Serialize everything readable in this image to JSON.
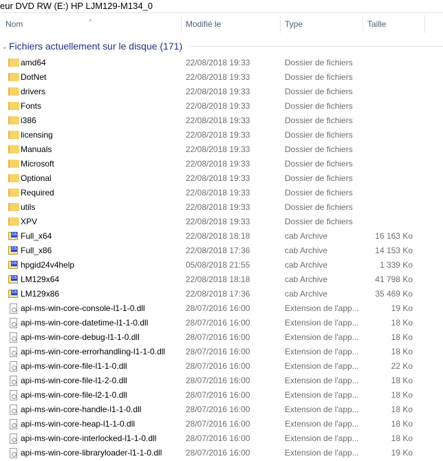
{
  "window": {
    "title": "eur DVD RW (E:) HP LJM129-M134_0"
  },
  "columns": {
    "name": "Nom",
    "modified": "Modifié le",
    "type": "Type",
    "size": "Taille"
  },
  "group": {
    "label": "Fichiers actuellement sur le disque (171)"
  },
  "files": [
    {
      "name": "amd64",
      "date": "22/08/2018 19:33",
      "type": "Dossier de fichiers",
      "size": "",
      "icon": "folder"
    },
    {
      "name": "DotNet",
      "date": "22/08/2018 19:33",
      "type": "Dossier de fichiers",
      "size": "",
      "icon": "folder"
    },
    {
      "name": "drivers",
      "date": "22/08/2018 19:33",
      "type": "Dossier de fichiers",
      "size": "",
      "icon": "folder"
    },
    {
      "name": "Fonts",
      "date": "22/08/2018 19:33",
      "type": "Dossier de fichiers",
      "size": "",
      "icon": "folder"
    },
    {
      "name": "i386",
      "date": "22/08/2018 19:33",
      "type": "Dossier de fichiers",
      "size": "",
      "icon": "folder"
    },
    {
      "name": "licensing",
      "date": "22/08/2018 19:33",
      "type": "Dossier de fichiers",
      "size": "",
      "icon": "folder"
    },
    {
      "name": "Manuals",
      "date": "22/08/2018 19:33",
      "type": "Dossier de fichiers",
      "size": "",
      "icon": "folder"
    },
    {
      "name": "Microsoft",
      "date": "22/08/2018 19:33",
      "type": "Dossier de fichiers",
      "size": "",
      "icon": "folder"
    },
    {
      "name": "Optional",
      "date": "22/08/2018 19:33",
      "type": "Dossier de fichiers",
      "size": "",
      "icon": "folder"
    },
    {
      "name": "Required",
      "date": "22/08/2018 19:33",
      "type": "Dossier de fichiers",
      "size": "",
      "icon": "folder"
    },
    {
      "name": "utils",
      "date": "22/08/2018 19:33",
      "type": "Dossier de fichiers",
      "size": "",
      "icon": "folder"
    },
    {
      "name": "XPV",
      "date": "22/08/2018 19:33",
      "type": "Dossier de fichiers",
      "size": "",
      "icon": "folder"
    },
    {
      "name": "Full_x64",
      "date": "22/08/2018 18:18",
      "type": "cab Archive",
      "size": "16 163 Ko",
      "icon": "cab"
    },
    {
      "name": "Full_x86",
      "date": "22/08/2018 17:36",
      "type": "cab Archive",
      "size": "14 153 Ko",
      "icon": "cab"
    },
    {
      "name": "hpgid24v4help",
      "date": "05/08/2018 21:55",
      "type": "cab Archive",
      "size": "1 339 Ko",
      "icon": "cab"
    },
    {
      "name": "LM129x64",
      "date": "22/08/2018 18:18",
      "type": "cab Archive",
      "size": "41 798 Ko",
      "icon": "cab"
    },
    {
      "name": "LM129x86",
      "date": "22/08/2018 17:36",
      "type": "cab Archive",
      "size": "35 469 Ko",
      "icon": "cab"
    },
    {
      "name": "api-ms-win-core-console-l1-1-0.dll",
      "date": "28/07/2016 16:00",
      "type": "Extension de l'app...",
      "size": "19 Ko",
      "icon": "dll"
    },
    {
      "name": "api-ms-win-core-datetime-l1-1-0.dll",
      "date": "28/07/2016 16:00",
      "type": "Extension de l'app...",
      "size": "18 Ko",
      "icon": "dll"
    },
    {
      "name": "api-ms-win-core-debug-l1-1-0.dll",
      "date": "28/07/2016 16:00",
      "type": "Extension de l'app...",
      "size": "18 Ko",
      "icon": "dll"
    },
    {
      "name": "api-ms-win-core-errorhandling-l1-1-0.dll",
      "date": "28/07/2016 16:00",
      "type": "Extension de l'app...",
      "size": "18 Ko",
      "icon": "dll"
    },
    {
      "name": "api-ms-win-core-file-l1-1-0.dll",
      "date": "28/07/2016 16:00",
      "type": "Extension de l'app...",
      "size": "22 Ko",
      "icon": "dll"
    },
    {
      "name": "api-ms-win-core-file-l1-2-0.dll",
      "date": "28/07/2016 16:00",
      "type": "Extension de l'app...",
      "size": "18 Ko",
      "icon": "dll"
    },
    {
      "name": "api-ms-win-core-file-l2-1-0.dll",
      "date": "28/07/2016 16:00",
      "type": "Extension de l'app...",
      "size": "18 Ko",
      "icon": "dll"
    },
    {
      "name": "api-ms-win-core-handle-l1-1-0.dll",
      "date": "28/07/2016 16:00",
      "type": "Extension de l'app...",
      "size": "18 Ko",
      "icon": "dll"
    },
    {
      "name": "api-ms-win-core-heap-l1-1-0.dll",
      "date": "28/07/2016 16:00",
      "type": "Extension de l'app...",
      "size": "18 Ko",
      "icon": "dll"
    },
    {
      "name": "api-ms-win-core-interlocked-l1-1-0.dll",
      "date": "28/07/2016 16:00",
      "type": "Extension de l'app...",
      "size": "18 Ko",
      "icon": "dll"
    },
    {
      "name": "api-ms-win-core-libraryloader-l1-1-0.dll",
      "date": "28/07/2016 16:00",
      "type": "Extension de l'app...",
      "size": "19 Ko",
      "icon": "dll"
    }
  ]
}
